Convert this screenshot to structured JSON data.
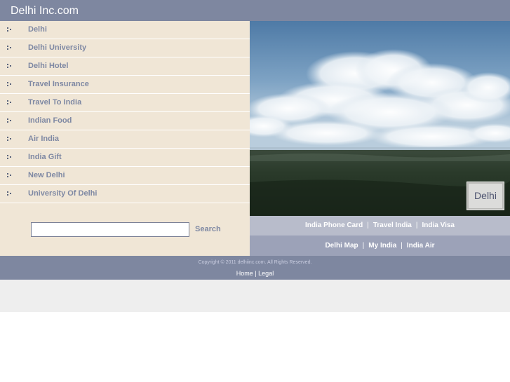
{
  "header": {
    "title": "Delhi Inc.com"
  },
  "sidebar": {
    "items": [
      {
        "label": "Delhi"
      },
      {
        "label": "Delhi University"
      },
      {
        "label": "Delhi Hotel"
      },
      {
        "label": "Travel Insurance"
      },
      {
        "label": "Travel To India"
      },
      {
        "label": "Indian Food"
      },
      {
        "label": "Air India"
      },
      {
        "label": "India Gift"
      },
      {
        "label": "New Delhi"
      },
      {
        "label": "University Of Delhi"
      }
    ],
    "search": {
      "value": "",
      "button_label": "Search"
    }
  },
  "hero": {
    "badge_text": "Delhi"
  },
  "links_row1": [
    {
      "label": "India Phone Card"
    },
    {
      "label": "Travel India"
    },
    {
      "label": "India Visa"
    }
  ],
  "links_row2": [
    {
      "label": "Delhi Map"
    },
    {
      "label": "My India"
    },
    {
      "label": "India Air"
    }
  ],
  "separator": "|",
  "footer": {
    "copyright": "Copyright © 2011 delhiinc.com. All Rights Reserved.",
    "home_label": "Home",
    "divider": "|",
    "legal_label": "Legal"
  },
  "colors": {
    "header_bg": "#7e87a0",
    "sidebar_bg": "#f0e6d6",
    "nav_text": "#7e88a3",
    "link_row1_bg": "#b8bccb",
    "link_row2_bg": "#9ca2b8",
    "footer_bg": "#7e87a0"
  }
}
